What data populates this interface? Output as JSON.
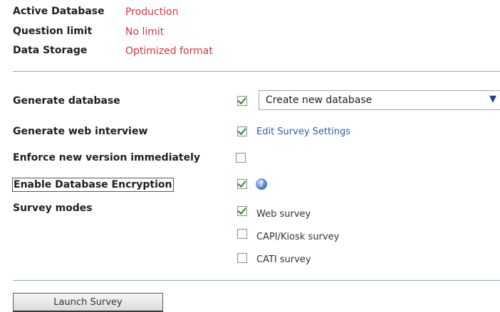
{
  "info": {
    "active_database_label": "Active Database",
    "active_database_value": "Production",
    "question_limit_label": "Question limit",
    "question_limit_value": "No limit",
    "data_storage_label": "Data Storage",
    "data_storage_value": "Optimized format"
  },
  "options": {
    "generate_database": {
      "label": "Generate database",
      "checked": true,
      "select_value": "Create new database"
    },
    "generate_web_interview": {
      "label": "Generate web interview",
      "checked": true,
      "link": "Edit Survey Settings"
    },
    "enforce_new_version": {
      "label": "Enforce new version immediately",
      "checked": false
    },
    "enable_db_encryption": {
      "label": "Enable Database Encryption",
      "checked": true
    },
    "survey_modes": {
      "label": "Survey modes",
      "modes": [
        {
          "label": "Web survey",
          "checked": true
        },
        {
          "label": "CAPI/Kiosk survey",
          "checked": false
        },
        {
          "label": "CATI survey",
          "checked": false
        }
      ]
    }
  },
  "launch_button": "Launch Survey",
  "colors": {
    "accent_red": "#d9343c",
    "link_blue": "#2a5db0",
    "check_green": "#2e8a2e"
  }
}
